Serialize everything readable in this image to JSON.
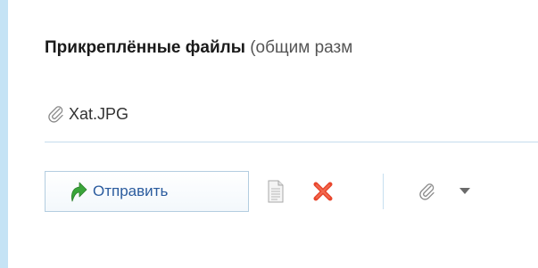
{
  "attachments": {
    "heading_bold": "Прикреплённые файлы",
    "heading_note": "(общим разм",
    "files": [
      {
        "name": "Xat.JPG",
        "icon": "paperclip-icon"
      }
    ]
  },
  "toolbar": {
    "send_label": "Отправить",
    "send_icon": "green-curved-arrow-icon",
    "buttons": [
      "document-icon",
      "delete-x-icon",
      "paperclip-icon",
      "dropdown-arrow-icon"
    ]
  },
  "colors": {
    "left_border": "#c5e3f5",
    "accent_link": "#2a5b9e",
    "send_arrow": "#3aa53a",
    "delete_red": "#e8452c",
    "divider": "#c5dced"
  }
}
